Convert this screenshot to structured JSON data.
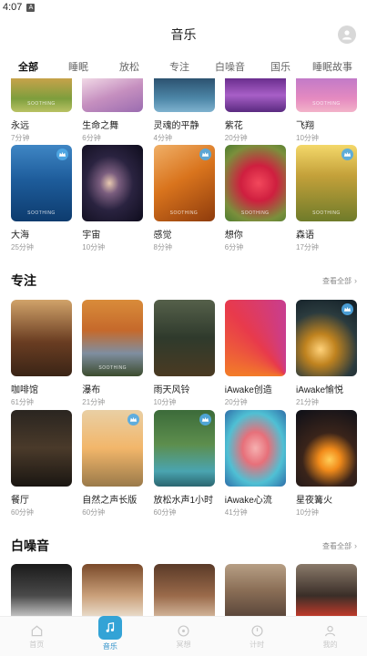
{
  "status_bar": {
    "time": "4:07",
    "notif": "A"
  },
  "header": {
    "title": "音乐"
  },
  "tabs": [
    {
      "label": "全部",
      "active": true
    },
    {
      "label": "睡眠"
    },
    {
      "label": "放松"
    },
    {
      "label": "专注"
    },
    {
      "label": "白噪音"
    },
    {
      "label": "国乐"
    },
    {
      "label": "睡眠故事"
    }
  ],
  "row_top": [
    {
      "title": "永远",
      "duration": "7分钟"
    },
    {
      "title": "生命之舞",
      "duration": "6分钟"
    },
    {
      "title": "灵魂的平静",
      "duration": "4分钟"
    },
    {
      "title": "紫花",
      "duration": "20分钟"
    },
    {
      "title": "飞翔",
      "duration": "10分钟"
    }
  ],
  "row_second": [
    {
      "title": "大海",
      "duration": "25分钟",
      "premium": true
    },
    {
      "title": "宇宙",
      "duration": "10分钟"
    },
    {
      "title": "感觉",
      "duration": "8分钟",
      "premium": true
    },
    {
      "title": "想你",
      "duration": "6分钟"
    },
    {
      "title": "森语",
      "duration": "17分钟",
      "premium": true
    }
  ],
  "focus_section": {
    "title": "专注",
    "see_all": "查看全部",
    "row1": [
      {
        "title": "咖啡馆",
        "duration": "61分钟"
      },
      {
        "title": "瀑布",
        "duration": "21分钟"
      },
      {
        "title": "雨天风铃",
        "duration": "10分钟"
      },
      {
        "title": "iAwake创造",
        "duration": "20分钟"
      },
      {
        "title": "iAwake愉悦",
        "duration": "21分钟",
        "premium": true
      }
    ],
    "row2": [
      {
        "title": "餐厅",
        "duration": "60分钟"
      },
      {
        "title": "自然之声长版",
        "duration": "60分钟",
        "premium": true
      },
      {
        "title": "放松水声1小时",
        "duration": "60分钟",
        "premium": true
      },
      {
        "title": "iAwake心流",
        "duration": "41分钟"
      },
      {
        "title": "星夜篝火",
        "duration": "10分钟"
      }
    ]
  },
  "noise_section": {
    "title": "白噪音",
    "see_all": "查看全部"
  },
  "watermark_text": "SOOTHING",
  "bottom_nav": [
    {
      "label": "首页",
      "icon": "home-icon"
    },
    {
      "label": "音乐",
      "icon": "music-note-icon",
      "active": true
    },
    {
      "label": "冥想",
      "icon": "meditation-icon"
    },
    {
      "label": "计时",
      "icon": "timer-icon"
    },
    {
      "label": "我的",
      "icon": "profile-icon"
    }
  ],
  "colors": {
    "accent": "#33a3d6",
    "tab_indicator": "#2a9df4"
  }
}
